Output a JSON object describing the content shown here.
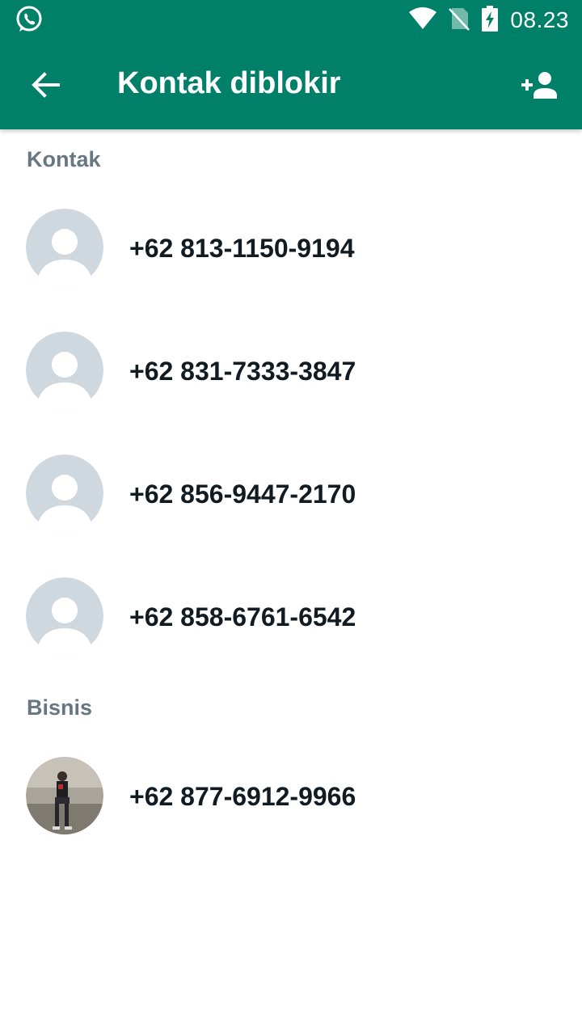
{
  "status_bar": {
    "app_icon": "whatsapp-icon",
    "icons": [
      "wifi-icon",
      "no-sim-icon",
      "battery-charging-icon"
    ],
    "time": "08.23"
  },
  "toolbar": {
    "back_icon": "arrow-left-icon",
    "title": "Kontak diblokir",
    "add_icon": "add-contact-icon"
  },
  "colors": {
    "header_bg": "#008069",
    "section_header": "#667781",
    "text_primary": "#111b21",
    "avatar_placeholder": "#cfd7df"
  },
  "sections": [
    {
      "header": "Kontak",
      "contacts": [
        {
          "phone": "+62 813-1150-9194",
          "avatar": "default-avatar-icon"
        },
        {
          "phone": "+62 831-7333-3847",
          "avatar": "default-avatar-icon"
        },
        {
          "phone": "+62 856-9447-2170",
          "avatar": "default-avatar-icon"
        },
        {
          "phone": "+62 858-6761-6542",
          "avatar": "default-avatar-icon"
        }
      ]
    },
    {
      "header": "Bisnis",
      "contacts": [
        {
          "phone": "+62 877-6912-9966",
          "avatar": "profile-photo"
        }
      ]
    }
  ]
}
